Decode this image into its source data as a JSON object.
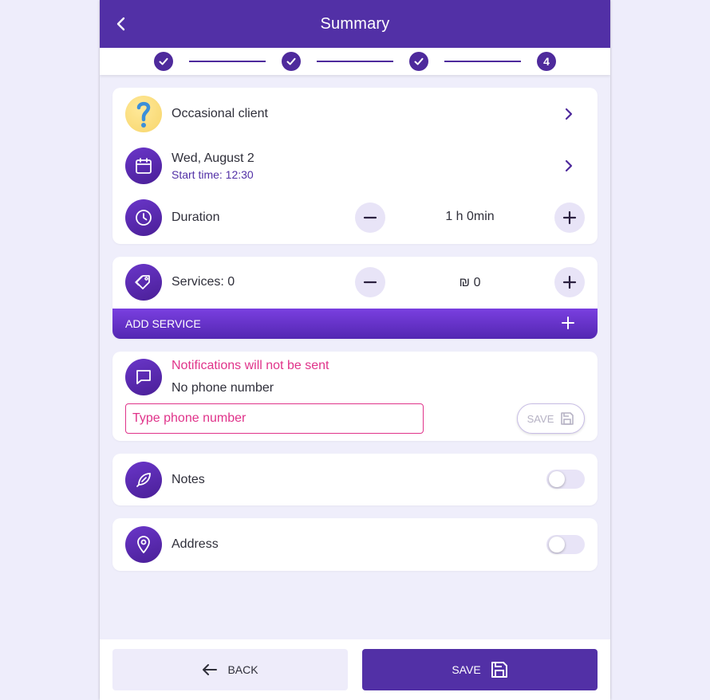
{
  "header": {
    "title": "Summary"
  },
  "stepper": {
    "current_step": "4"
  },
  "client": {
    "label": "Occasional client"
  },
  "appointment": {
    "date": "Wed, August 2",
    "start_time": "Start time: 12:30"
  },
  "duration": {
    "label": "Duration",
    "value": "1 h 0min"
  },
  "services": {
    "label": "Services: 0",
    "price": "₪ 0",
    "add_label": "ADD SERVICE"
  },
  "notifications": {
    "title": "Notifications will not be sent",
    "subtitle": "No phone number",
    "phone_placeholder": "Type phone number",
    "save_label": "SAVE"
  },
  "notes": {
    "label": "Notes",
    "enabled": false
  },
  "address": {
    "label": "Address",
    "enabled": false
  },
  "footer": {
    "back_label": "BACK",
    "save_label": "SAVE"
  },
  "colors": {
    "primary": "#5230a6",
    "accent_pink": "#e0338a",
    "background": "#eeedfb"
  }
}
